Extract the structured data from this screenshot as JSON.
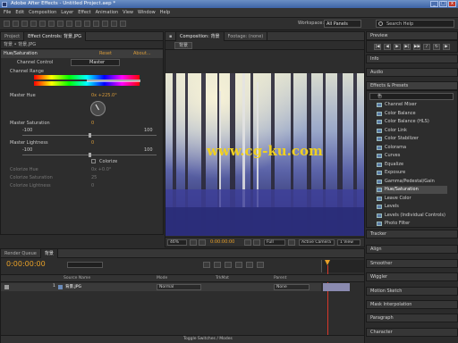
{
  "window": {
    "title": "Adobe After Effects - Untitled Project.aep *",
    "min_label": "_",
    "max_label": "□",
    "close_label": "x"
  },
  "menu": [
    "File",
    "Edit",
    "Composition",
    "Layer",
    "Effect",
    "Animation",
    "View",
    "Window",
    "Help"
  ],
  "toolbar": {
    "workspace_label": "Workspace:",
    "workspace_value": "All Panels",
    "search_placeholder": "Search Help"
  },
  "project_panel": {
    "tab_project": "Project",
    "tab_effect_controls": "Effect Controls: 背景.JPG",
    "sub_header": "背景 • 背景.JPG"
  },
  "effect_controls": {
    "effect_name": "Hue/Saturation",
    "reset_label": "Reset",
    "about_label": "About...",
    "channel_control_label": "Channel Control",
    "channel_control_value": "Master",
    "channel_range_label": "Channel Range",
    "master_hue_label": "Master Hue",
    "master_hue_value": "0x +225.0°",
    "master_sat_label": "Master Saturation",
    "master_sat_value": "0",
    "sat_min": "-100",
    "sat_max": "100",
    "master_light_label": "Master Lightness",
    "master_light_value": "0",
    "light_min": "-100",
    "light_max": "100",
    "colorize_label": "Colorize",
    "colorize_hue_label": "Colorize Hue",
    "colorize_hue_value": "0x +0.0°",
    "colorize_sat_label": "Colorize Saturation",
    "colorize_sat_value": "25",
    "colorize_light_label": "Colorize Lightness",
    "colorize_light_value": "0"
  },
  "composition_panel": {
    "tab_comp": "Composition: 背景",
    "tab_footage": "Footage: (none)",
    "comp_tab_label": "背景",
    "watermark": "www.cg-ku.com",
    "zoom": "46%",
    "timecode": "0:00:00:00",
    "resolution": "Full",
    "camera": "Active Camera",
    "view": "1 View"
  },
  "right_panels": {
    "preview": "Preview",
    "info": "Info",
    "audio": "Audio",
    "effects_presets": "Effects & Presets",
    "effects_search": "色",
    "effects": [
      "Channel Mixer",
      "Color Balance",
      "Color Balance (HLS)",
      "Color Link",
      "Color Stabilizer",
      "Colorama",
      "Curves",
      "Equalize",
      "Exposure",
      "Gamma/Pedestal/Gain",
      "Hue/Saturation",
      "Leave Color",
      "Levels",
      "Levels (Individual Controls)",
      "Photo Filter"
    ],
    "selected_effect": "Hue/Saturation",
    "tracker": "Tracker",
    "align": "Align",
    "smoother": "Smoother",
    "wiggler": "Wiggler",
    "motion_sketch": "Motion Sketch",
    "mask_interpolation": "Mask Interpolation",
    "paragraph": "Paragraph",
    "character": "Character"
  },
  "timeline": {
    "tab_render": "Render Queue",
    "tab_comp": "背景",
    "timecode": "0:00:00:00",
    "col_source": "Source Name",
    "col_mode": "Mode",
    "col_trkmat": "TrkMat",
    "col_parent": "Parent",
    "layer_num": "1",
    "layer_name": "背景.JPG",
    "layer_mode": "Normal",
    "layer_parent": "None",
    "toggle_label": "Toggle Switches / Modes"
  },
  "colors": {
    "accent_orange": "#d89b3a",
    "timecode_orange": "#e8a028",
    "watermark_yellow": "#f0d020",
    "selection": "#4a4a4a"
  }
}
